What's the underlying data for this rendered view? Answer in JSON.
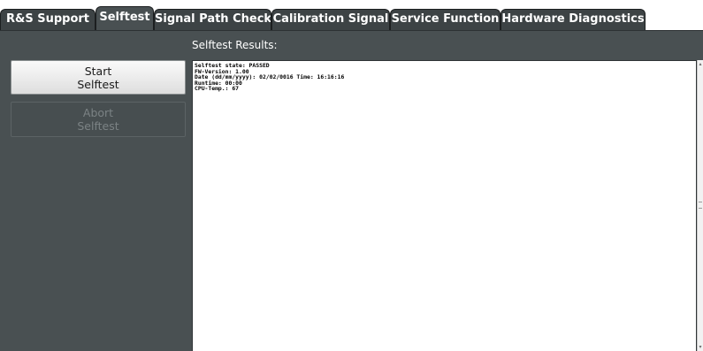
{
  "tabs": [
    {
      "label": "R&S Support",
      "active": false
    },
    {
      "label": "Selftest",
      "active": true
    },
    {
      "label": "Signal Path Check",
      "active": false
    },
    {
      "label": "Calibration Signal",
      "active": false
    },
    {
      "label": "Service Function",
      "active": false
    },
    {
      "label": "Hardware Diagnostics",
      "active": false
    }
  ],
  "panel": {
    "results_title": "Selftest Results:",
    "start_button": {
      "line1": "Start",
      "line2": "Selftest"
    },
    "abort_button": {
      "line1": "Abort",
      "line2": "Selftest",
      "enabled": false
    },
    "results_lines": [
      "Selftest state: PASSED",
      "FW-Version: 1.00",
      "Date (dd/mm/yyyy): 02/02/0016 Time: 16:16:16",
      "Runtime: 00:00",
      "CPU-Temp.: 67"
    ]
  },
  "colors": {
    "panel_bg": "#495052",
    "tab_bg": "#3d4345",
    "results_bg": "#ffffff"
  },
  "icons": {
    "scroll_up": "scroll-up-icon",
    "scroll_down": "scroll-down-icon"
  }
}
